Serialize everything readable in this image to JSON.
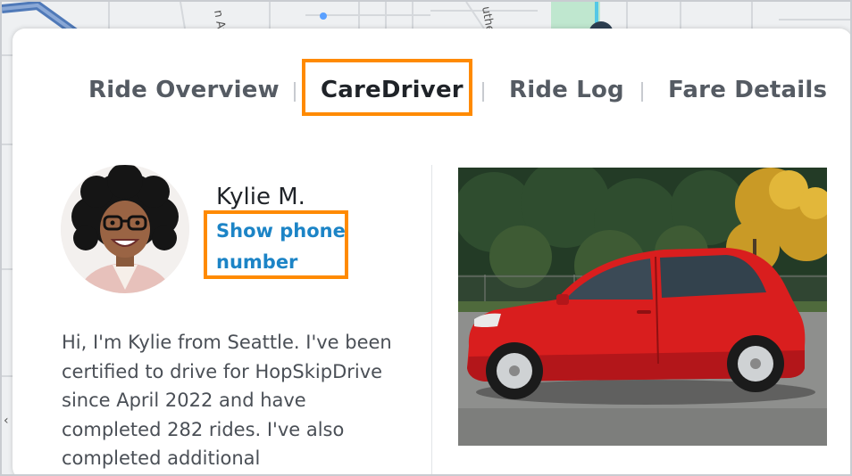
{
  "tabs": [
    {
      "label": "Ride Overview",
      "active": false
    },
    {
      "label": "CareDriver",
      "active": true
    },
    {
      "label": "Ride Log",
      "active": false
    },
    {
      "label": "Fare Details",
      "active": false
    }
  ],
  "map": {
    "street_labels": [
      "n Av",
      "uthe"
    ]
  },
  "driver": {
    "name": "Kylie M.",
    "show_phone_label": "Show phone number",
    "bio": "Hi, I'm Kylie from Seattle. I've been certified to drive for HopSkipDrive since April 2022 and have completed 282 rides. I've also completed additional"
  },
  "colors": {
    "highlight": "#ff8a00",
    "link": "#1c84c6",
    "car": "#d91e1e"
  },
  "icons": {
    "map_chevron": "chevron-left-icon"
  }
}
